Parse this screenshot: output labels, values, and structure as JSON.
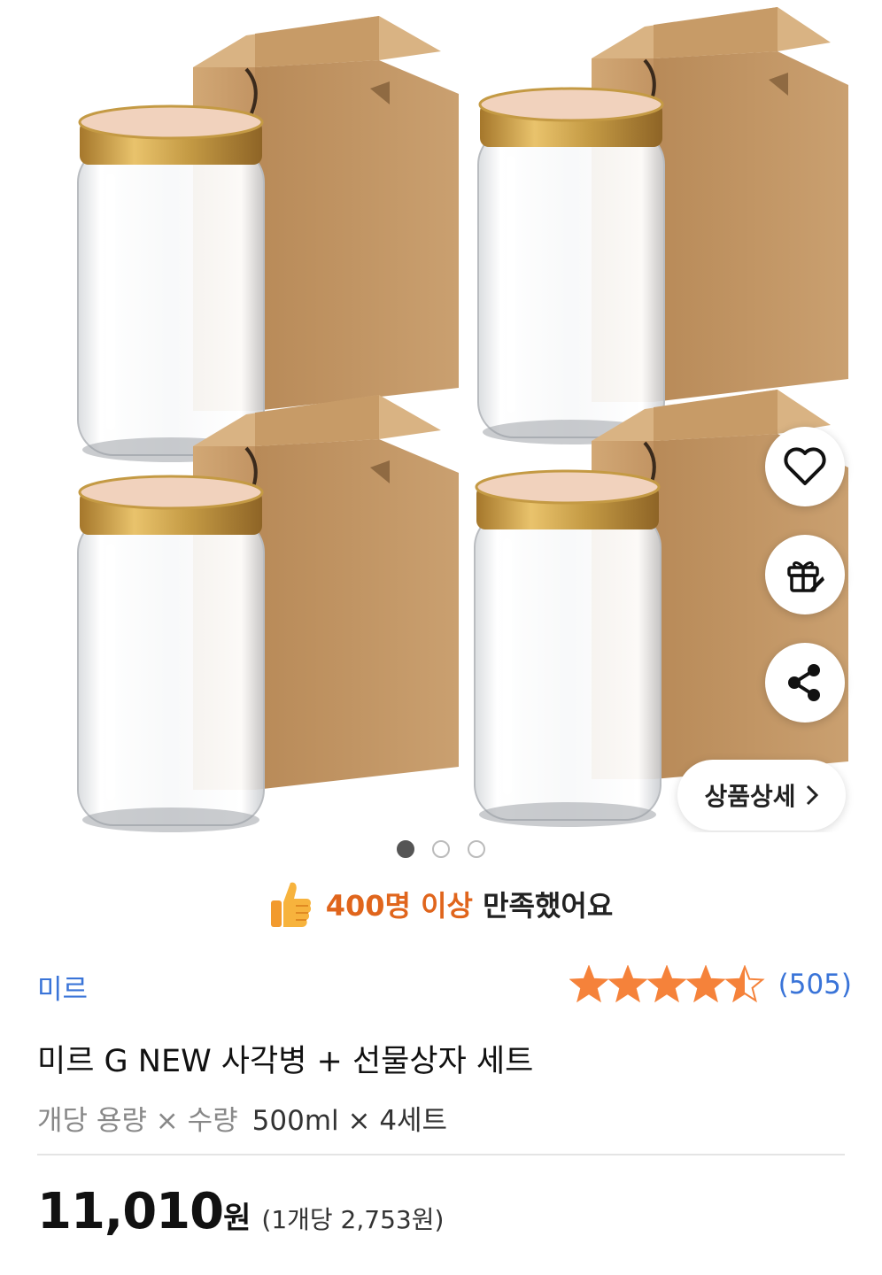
{
  "hero": {
    "pager": {
      "count": 3,
      "active": 0
    },
    "detail_button": "상품상세",
    "fab_icons": [
      "heart-icon",
      "gift-icon",
      "share-icon"
    ]
  },
  "satisfaction": {
    "highlight": "400명 이상",
    "rest": " 만족했어요",
    "icon": "thumbs-up-icon"
  },
  "product": {
    "brand": "미르",
    "rating": {
      "value": 4.5,
      "max": 5,
      "count_text": "(505)",
      "star_color": "#f5823a"
    },
    "title": "미르 G NEW 사각병 + 선물상자 세트",
    "spec_label": "개당 용량 × 수량",
    "spec_value": "500ml × 4세트",
    "price": "11,010",
    "price_unit": "원",
    "unit_price": "(1개당 2,753원)"
  },
  "colors": {
    "link": "#3a74d8",
    "accent": "#e0651c",
    "box": "#c99b66",
    "lid": "#c9a04a"
  }
}
